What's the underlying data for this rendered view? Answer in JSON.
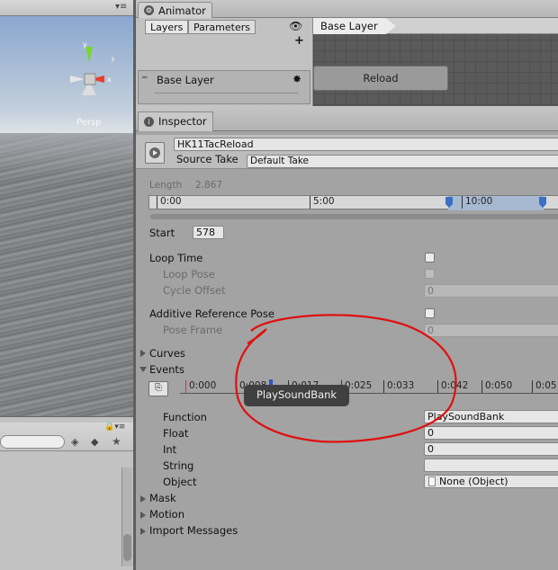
{
  "scene": {
    "view_label": "Persp",
    "axes": [
      "y",
      "x"
    ]
  },
  "animator": {
    "tab_title": "Animator",
    "tabs": [
      "Layers",
      "Parameters"
    ],
    "layer_name": "Base Layer",
    "breadcrumb": "Base Layer",
    "state_name": "Reload"
  },
  "inspector": {
    "tab_title": "Inspector",
    "clip_name": "HK11TacReload",
    "source_take_label": "Source Take",
    "source_take_value": "Default Take",
    "length_label": "Length",
    "length_value": "2.867",
    "timeline_ticks": [
      "0:00",
      "5:00",
      "10:00"
    ],
    "start_label": "Start",
    "start_value": "578",
    "loop_time_label": "Loop Time",
    "loop_pose_label": "Loop Pose",
    "cycle_offset_label": "Cycle Offset",
    "cycle_offset_value": "0",
    "additive_label": "Additive Reference Pose",
    "pose_frame_label": "Pose Frame",
    "pose_frame_value": "0",
    "curves_label": "Curves",
    "events_label": "Events",
    "event_ticks": [
      "0:000",
      "0:008",
      "0:017",
      "0:025",
      "0:033",
      "0:042",
      "0:050",
      "0:05"
    ],
    "tooltip": "PlaySoundBank",
    "function_label": "Function",
    "function_value": "PlaySoundBank",
    "float_label": "Float",
    "float_value": "0",
    "int_label": "Int",
    "int_value": "0",
    "string_label": "String",
    "string_value": "",
    "object_label": "Object",
    "object_value": "None (Object)",
    "mask_label": "Mask",
    "motion_label": "Motion",
    "import_label": "Import Messages"
  },
  "colors": {
    "annotation_circle": "#e01010",
    "selection_range": "#a7b8d1"
  }
}
